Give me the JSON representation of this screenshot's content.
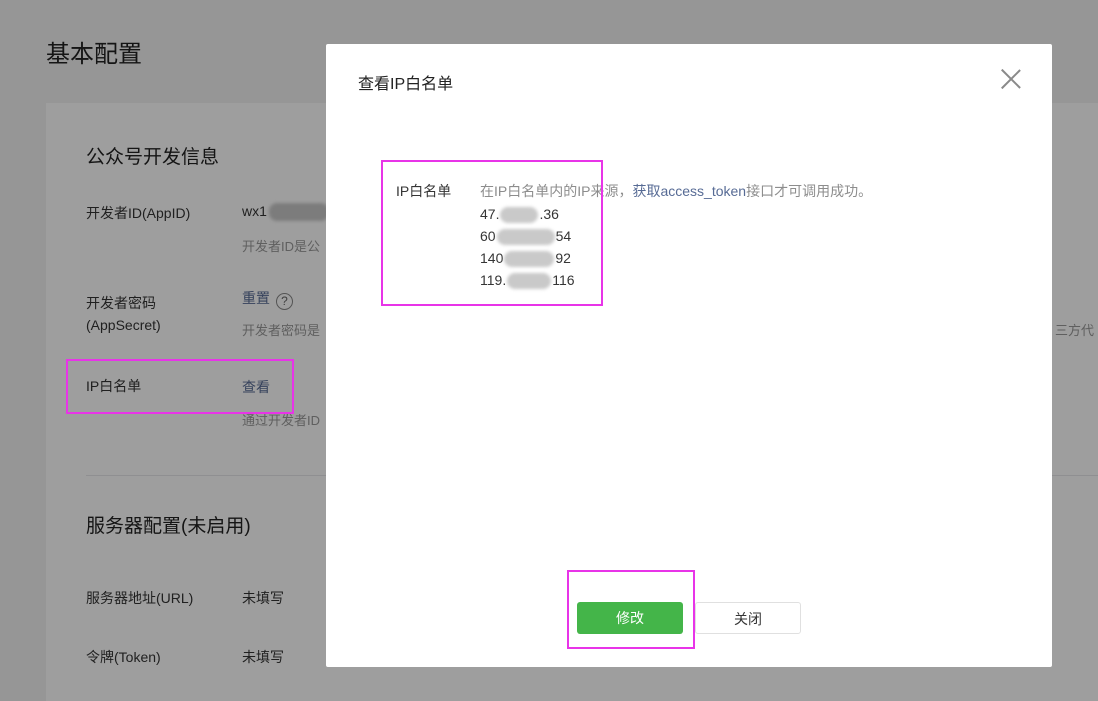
{
  "page": {
    "title": "基本配置",
    "dev_section_title": "公众号开发信息",
    "appid_label": "开发者ID(AppID)",
    "appid_prefix": "wx1",
    "appid_hint": "开发者ID是公",
    "secret_label_line1": "开发者密码",
    "secret_label_line2": "(AppSecret)",
    "secret_reset": "重置",
    "secret_help": "?",
    "secret_hint": "开发者密码是",
    "secret_hint_right": "三方代",
    "ip_label": "IP白名单",
    "ip_view_link": "查看",
    "ip_hint": "通过开发者ID",
    "server_section_title": "服务器配置(未启用)",
    "server_url_label": "服务器地址(URL)",
    "server_url_value": "未填写",
    "token_label": "令牌(Token)",
    "token_value": "未填写"
  },
  "dialog": {
    "title": "查看IP白名单",
    "whitelist_label": "IP白名单",
    "desc_text": "在IP白名单内的IP来源，",
    "desc_link": "获取access_token",
    "desc_tail": "接口才可调用成功。",
    "ips": [
      {
        "prefix": "47.",
        "suffix": ".36"
      },
      {
        "prefix": "60",
        "suffix": "54"
      },
      {
        "prefix": "140",
        "suffix": "92"
      },
      {
        "prefix": "119.",
        "suffix": "116"
      }
    ],
    "modify_button": "修改",
    "close_button": "关闭"
  },
  "colors": {
    "primary": "#44b549",
    "link": "#576b95",
    "highlight": "#e834e8"
  }
}
